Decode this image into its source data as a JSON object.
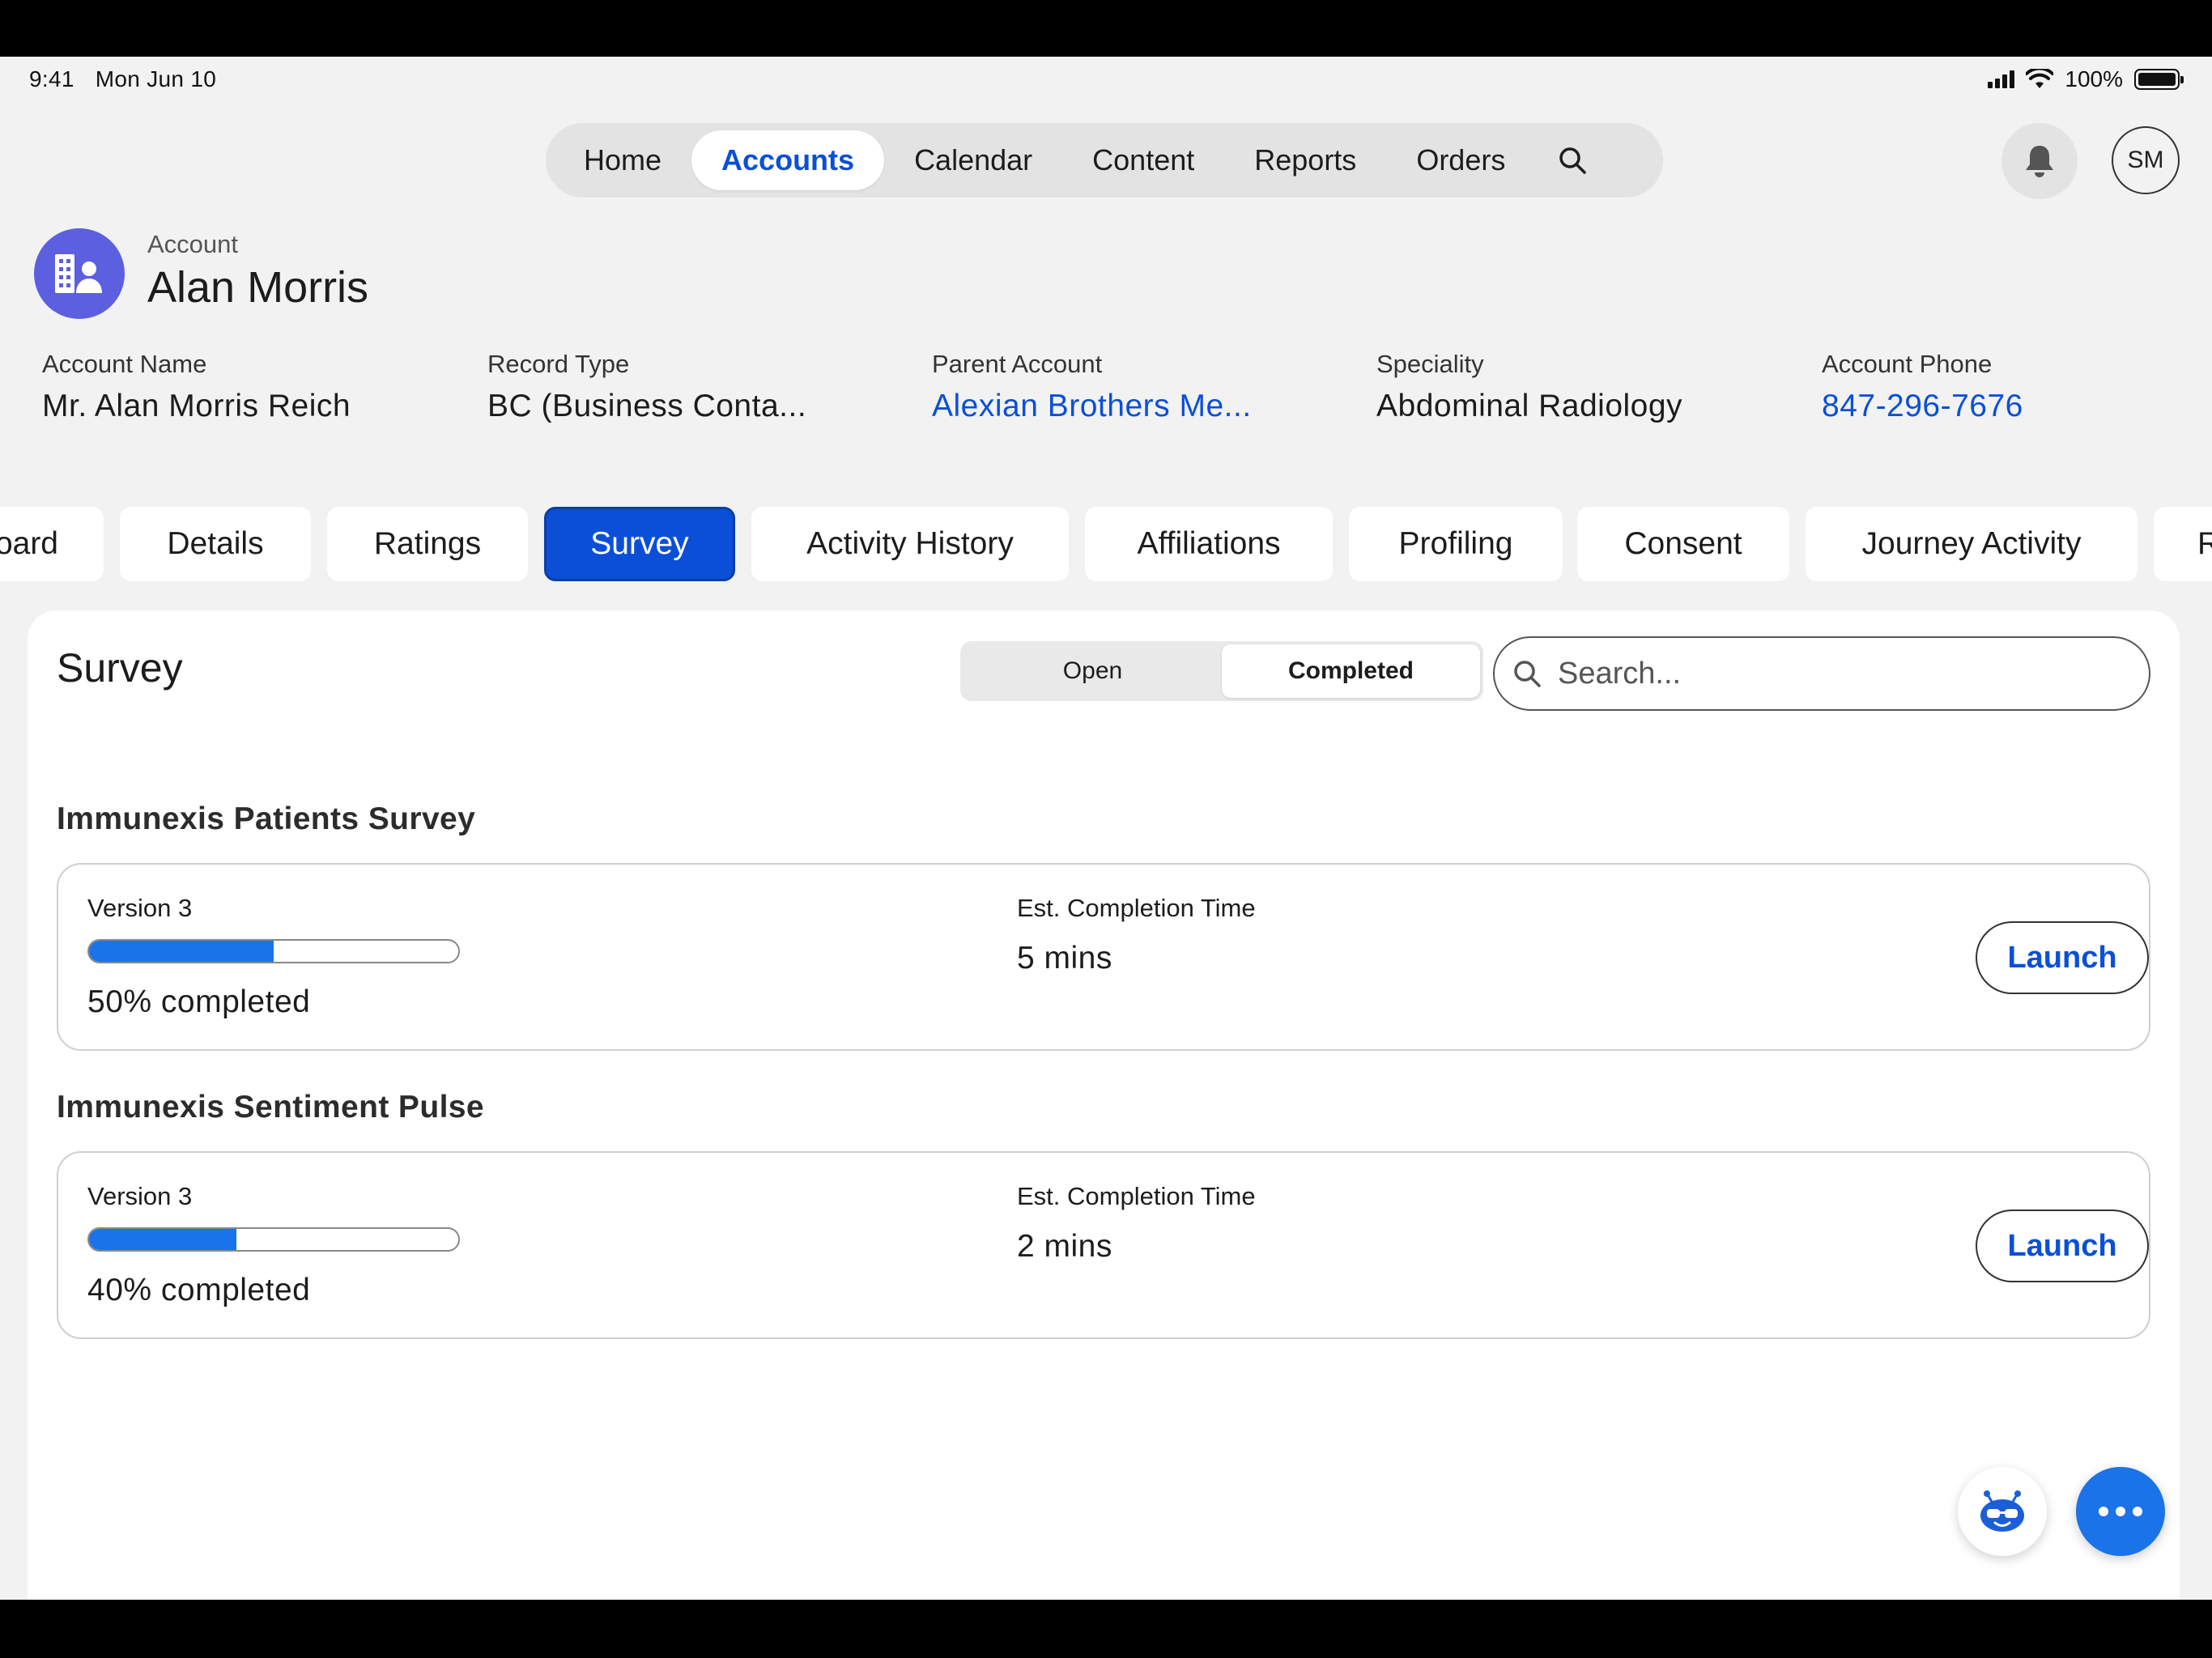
{
  "status_bar": {
    "time": "9:41",
    "date": "Mon Jun 10",
    "battery": "100%"
  },
  "top_nav": {
    "items": [
      {
        "label": "Home",
        "active": false
      },
      {
        "label": "Accounts",
        "active": true
      },
      {
        "label": "Calendar",
        "active": false
      },
      {
        "label": "Content",
        "active": false
      },
      {
        "label": "Reports",
        "active": false
      },
      {
        "label": "Orders",
        "active": false
      }
    ],
    "search_icon": "search-icon",
    "notification_icon": "bell-icon",
    "user_initials": "SM"
  },
  "account": {
    "kicker": "Account",
    "name": "Alan Morris",
    "fields": [
      {
        "label": "Account Name",
        "value": "Mr. Alan Morris Reich",
        "link": false
      },
      {
        "label": "Record Type",
        "value": "BC (Business Conta...",
        "link": false
      },
      {
        "label": "Parent Account",
        "value": "Alexian Brothers Me...",
        "link": true
      },
      {
        "label": "Speciality",
        "value": "Abdominal Radiology",
        "link": false
      },
      {
        "label": "Account Phone",
        "value": "847-296-7676",
        "link": true
      }
    ]
  },
  "tabs": [
    {
      "label": "oard",
      "active": false
    },
    {
      "label": "Details",
      "active": false
    },
    {
      "label": "Ratings",
      "active": false
    },
    {
      "label": "Survey",
      "active": true
    },
    {
      "label": "Activity History",
      "active": false
    },
    {
      "label": "Affiliations",
      "active": false
    },
    {
      "label": "Profiling",
      "active": false
    },
    {
      "label": "Consent",
      "active": false
    },
    {
      "label": "Journey Activity",
      "active": false
    },
    {
      "label": "R",
      "active": false
    }
  ],
  "survey": {
    "title": "Survey",
    "segments": [
      {
        "label": "Open",
        "active": false
      },
      {
        "label": "Completed",
        "active": true
      }
    ],
    "search_placeholder": "Search...",
    "items": [
      {
        "name": "Immunexis Patients Survey",
        "version": "Version 3",
        "progress": 0.5,
        "progress_text": "50% completed",
        "est_label": "Est. Completion Time",
        "est_value": "5 mins",
        "action": "Launch"
      },
      {
        "name": "Immunexis Sentiment Pulse",
        "version": "Version 3",
        "progress": 0.4,
        "progress_text": "40% completed",
        "est_label": "Est. Completion Time",
        "est_value": "2 mins",
        "action": "Launch"
      }
    ]
  },
  "colors": {
    "accent": "#0b4fd8",
    "progress": "#1a73e8",
    "account_icon": "#5b5fe0"
  },
  "fab": {
    "assistant_icon": "robot-assistant-icon",
    "more_icon": "more-dots-icon"
  }
}
